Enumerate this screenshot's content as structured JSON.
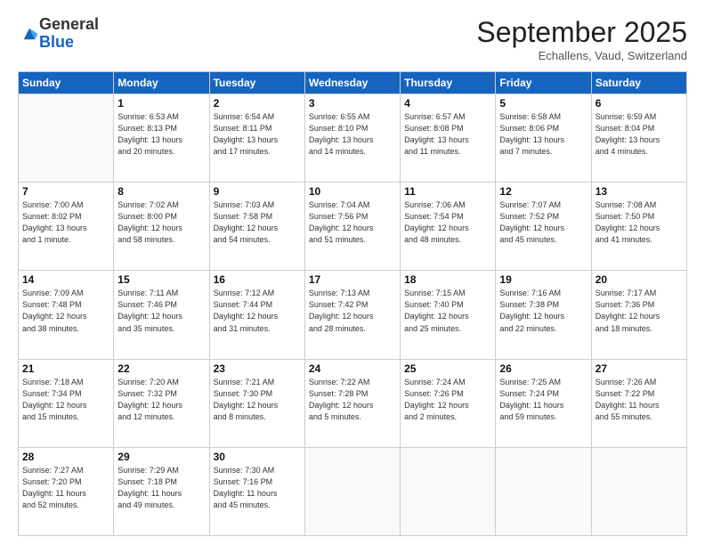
{
  "logo": {
    "general": "General",
    "blue": "Blue"
  },
  "header": {
    "month": "September 2025",
    "location": "Echallens, Vaud, Switzerland"
  },
  "weekdays": [
    "Sunday",
    "Monday",
    "Tuesday",
    "Wednesday",
    "Thursday",
    "Friday",
    "Saturday"
  ],
  "weeks": [
    [
      {
        "day": "",
        "info": ""
      },
      {
        "day": "1",
        "info": "Sunrise: 6:53 AM\nSunset: 8:13 PM\nDaylight: 13 hours\nand 20 minutes."
      },
      {
        "day": "2",
        "info": "Sunrise: 6:54 AM\nSunset: 8:11 PM\nDaylight: 13 hours\nand 17 minutes."
      },
      {
        "day": "3",
        "info": "Sunrise: 6:55 AM\nSunset: 8:10 PM\nDaylight: 13 hours\nand 14 minutes."
      },
      {
        "day": "4",
        "info": "Sunrise: 6:57 AM\nSunset: 8:08 PM\nDaylight: 13 hours\nand 11 minutes."
      },
      {
        "day": "5",
        "info": "Sunrise: 6:58 AM\nSunset: 8:06 PM\nDaylight: 13 hours\nand 7 minutes."
      },
      {
        "day": "6",
        "info": "Sunrise: 6:59 AM\nSunset: 8:04 PM\nDaylight: 13 hours\nand 4 minutes."
      }
    ],
    [
      {
        "day": "7",
        "info": "Sunrise: 7:00 AM\nSunset: 8:02 PM\nDaylight: 13 hours\nand 1 minute."
      },
      {
        "day": "8",
        "info": "Sunrise: 7:02 AM\nSunset: 8:00 PM\nDaylight: 12 hours\nand 58 minutes."
      },
      {
        "day": "9",
        "info": "Sunrise: 7:03 AM\nSunset: 7:58 PM\nDaylight: 12 hours\nand 54 minutes."
      },
      {
        "day": "10",
        "info": "Sunrise: 7:04 AM\nSunset: 7:56 PM\nDaylight: 12 hours\nand 51 minutes."
      },
      {
        "day": "11",
        "info": "Sunrise: 7:06 AM\nSunset: 7:54 PM\nDaylight: 12 hours\nand 48 minutes."
      },
      {
        "day": "12",
        "info": "Sunrise: 7:07 AM\nSunset: 7:52 PM\nDaylight: 12 hours\nand 45 minutes."
      },
      {
        "day": "13",
        "info": "Sunrise: 7:08 AM\nSunset: 7:50 PM\nDaylight: 12 hours\nand 41 minutes."
      }
    ],
    [
      {
        "day": "14",
        "info": "Sunrise: 7:09 AM\nSunset: 7:48 PM\nDaylight: 12 hours\nand 38 minutes."
      },
      {
        "day": "15",
        "info": "Sunrise: 7:11 AM\nSunset: 7:46 PM\nDaylight: 12 hours\nand 35 minutes."
      },
      {
        "day": "16",
        "info": "Sunrise: 7:12 AM\nSunset: 7:44 PM\nDaylight: 12 hours\nand 31 minutes."
      },
      {
        "day": "17",
        "info": "Sunrise: 7:13 AM\nSunset: 7:42 PM\nDaylight: 12 hours\nand 28 minutes."
      },
      {
        "day": "18",
        "info": "Sunrise: 7:15 AM\nSunset: 7:40 PM\nDaylight: 12 hours\nand 25 minutes."
      },
      {
        "day": "19",
        "info": "Sunrise: 7:16 AM\nSunset: 7:38 PM\nDaylight: 12 hours\nand 22 minutes."
      },
      {
        "day": "20",
        "info": "Sunrise: 7:17 AM\nSunset: 7:36 PM\nDaylight: 12 hours\nand 18 minutes."
      }
    ],
    [
      {
        "day": "21",
        "info": "Sunrise: 7:18 AM\nSunset: 7:34 PM\nDaylight: 12 hours\nand 15 minutes."
      },
      {
        "day": "22",
        "info": "Sunrise: 7:20 AM\nSunset: 7:32 PM\nDaylight: 12 hours\nand 12 minutes."
      },
      {
        "day": "23",
        "info": "Sunrise: 7:21 AM\nSunset: 7:30 PM\nDaylight: 12 hours\nand 8 minutes."
      },
      {
        "day": "24",
        "info": "Sunrise: 7:22 AM\nSunset: 7:28 PM\nDaylight: 12 hours\nand 5 minutes."
      },
      {
        "day": "25",
        "info": "Sunrise: 7:24 AM\nSunset: 7:26 PM\nDaylight: 12 hours\nand 2 minutes."
      },
      {
        "day": "26",
        "info": "Sunrise: 7:25 AM\nSunset: 7:24 PM\nDaylight: 11 hours\nand 59 minutes."
      },
      {
        "day": "27",
        "info": "Sunrise: 7:26 AM\nSunset: 7:22 PM\nDaylight: 11 hours\nand 55 minutes."
      }
    ],
    [
      {
        "day": "28",
        "info": "Sunrise: 7:27 AM\nSunset: 7:20 PM\nDaylight: 11 hours\nand 52 minutes."
      },
      {
        "day": "29",
        "info": "Sunrise: 7:29 AM\nSunset: 7:18 PM\nDaylight: 11 hours\nand 49 minutes."
      },
      {
        "day": "30",
        "info": "Sunrise: 7:30 AM\nSunset: 7:16 PM\nDaylight: 11 hours\nand 45 minutes."
      },
      {
        "day": "",
        "info": ""
      },
      {
        "day": "",
        "info": ""
      },
      {
        "day": "",
        "info": ""
      },
      {
        "day": "",
        "info": ""
      }
    ]
  ]
}
